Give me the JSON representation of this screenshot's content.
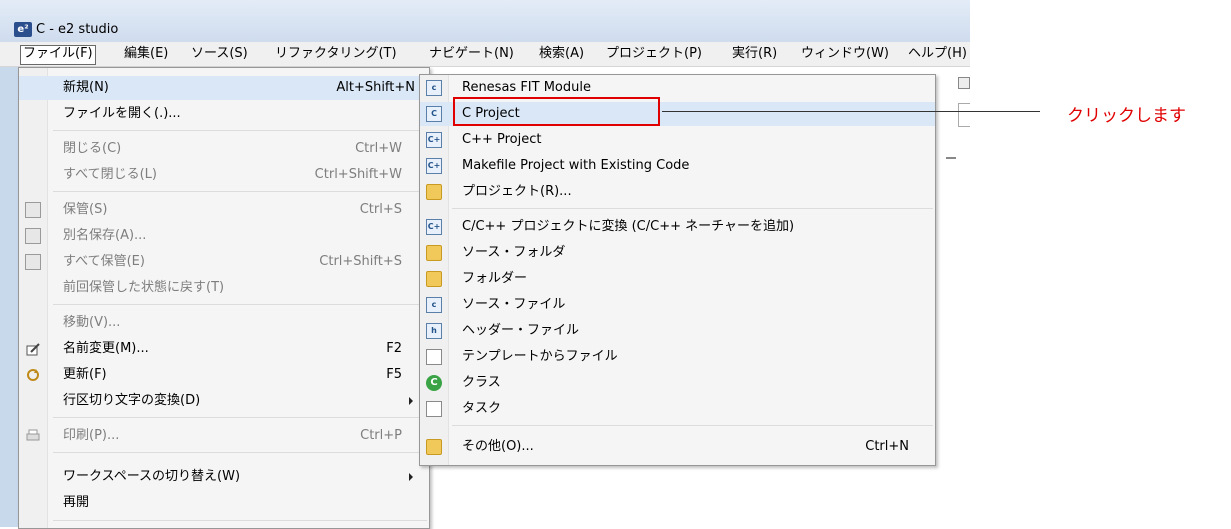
{
  "window": {
    "title": "C - e2 studio",
    "logo": "e²"
  },
  "menubar": [
    "ファイル(F)",
    "編集(E)",
    "ソース(S)",
    "リファクタリング(T)",
    "ナビゲート(N)",
    "検索(A)",
    "プロジェクト(P)",
    "実行(R)",
    "ウィンドウ(W)",
    "ヘルプ(H)"
  ],
  "file_menu": {
    "items": [
      {
        "label": "新規(N)",
        "shortcut": "Alt+Shift+N",
        "submenu": true,
        "enabled": true
      },
      {
        "label": "ファイルを開く(.)...",
        "shortcut": "",
        "enabled": true
      },
      {
        "label": "閉じる(C)",
        "shortcut": "Ctrl+W",
        "enabled": false
      },
      {
        "label": "すべて閉じる(L)",
        "shortcut": "Ctrl+Shift+W",
        "enabled": false
      },
      {
        "label": "保管(S)",
        "shortcut": "Ctrl+S",
        "enabled": false,
        "icon": "save-icon"
      },
      {
        "label": "別名保存(A)...",
        "shortcut": "",
        "enabled": false,
        "icon": "save-as-icon"
      },
      {
        "label": "すべて保管(E)",
        "shortcut": "Ctrl+Shift+S",
        "enabled": false,
        "icon": "save-all-icon"
      },
      {
        "label": "前回保管した状態に戻す(T)",
        "shortcut": "",
        "enabled": false
      },
      {
        "label": "移動(V)...",
        "shortcut": "",
        "enabled": false
      },
      {
        "label": "名前変更(M)...",
        "shortcut": "F2",
        "enabled": true,
        "icon": "rename-icon"
      },
      {
        "label": "更新(F)",
        "shortcut": "F5",
        "enabled": true,
        "icon": "refresh-icon"
      },
      {
        "label": "行区切り文字の変換(D)",
        "shortcut": "",
        "submenu": true,
        "enabled": true
      },
      {
        "label": "印刷(P)...",
        "shortcut": "Ctrl+P",
        "enabled": false,
        "icon": "print-icon"
      },
      {
        "label": "ワークスペースの切り替え(W)",
        "shortcut": "",
        "submenu": true,
        "enabled": true
      },
      {
        "label": "再開",
        "shortcut": "",
        "enabled": true
      }
    ]
  },
  "new_submenu": {
    "items": [
      {
        "label": "Renesas FIT Module",
        "icon": "renesas-fit-module-icon"
      },
      {
        "label": "C Project",
        "icon": "c-project-icon"
      },
      {
        "label": "C++ Project",
        "icon": "cpp-project-icon"
      },
      {
        "label": "Makefile Project with Existing Code",
        "icon": "makefile-project-icon"
      },
      {
        "label": "プロジェクト(R)...",
        "icon": "project-icon"
      },
      {
        "label": "C/C++ プロジェクトに変換 (C/C++ ネーチャーを追加)",
        "icon": "convert-project-icon"
      },
      {
        "label": "ソース・フォルダ",
        "icon": "source-folder-icon"
      },
      {
        "label": "フォルダー",
        "icon": "folder-icon"
      },
      {
        "label": "ソース・ファイル",
        "icon": "source-file-icon"
      },
      {
        "label": "ヘッダー・ファイル",
        "icon": "header-file-icon"
      },
      {
        "label": "テンプレートからファイル",
        "icon": "file-from-template-icon"
      },
      {
        "label": "クラス",
        "icon": "class-icon"
      },
      {
        "label": "タスク",
        "icon": "task-icon"
      },
      {
        "label": "その他(O)...",
        "icon": "other-icon",
        "shortcut": "Ctrl+N"
      }
    ]
  },
  "annotation": {
    "text": "クリックします",
    "color": "#e00000"
  },
  "colors": {
    "highlight": "#d9e7f7",
    "annotation_red": "#e00000",
    "menu_bg": "#f5f5f5",
    "disabled_text": "#7e7e7e"
  }
}
